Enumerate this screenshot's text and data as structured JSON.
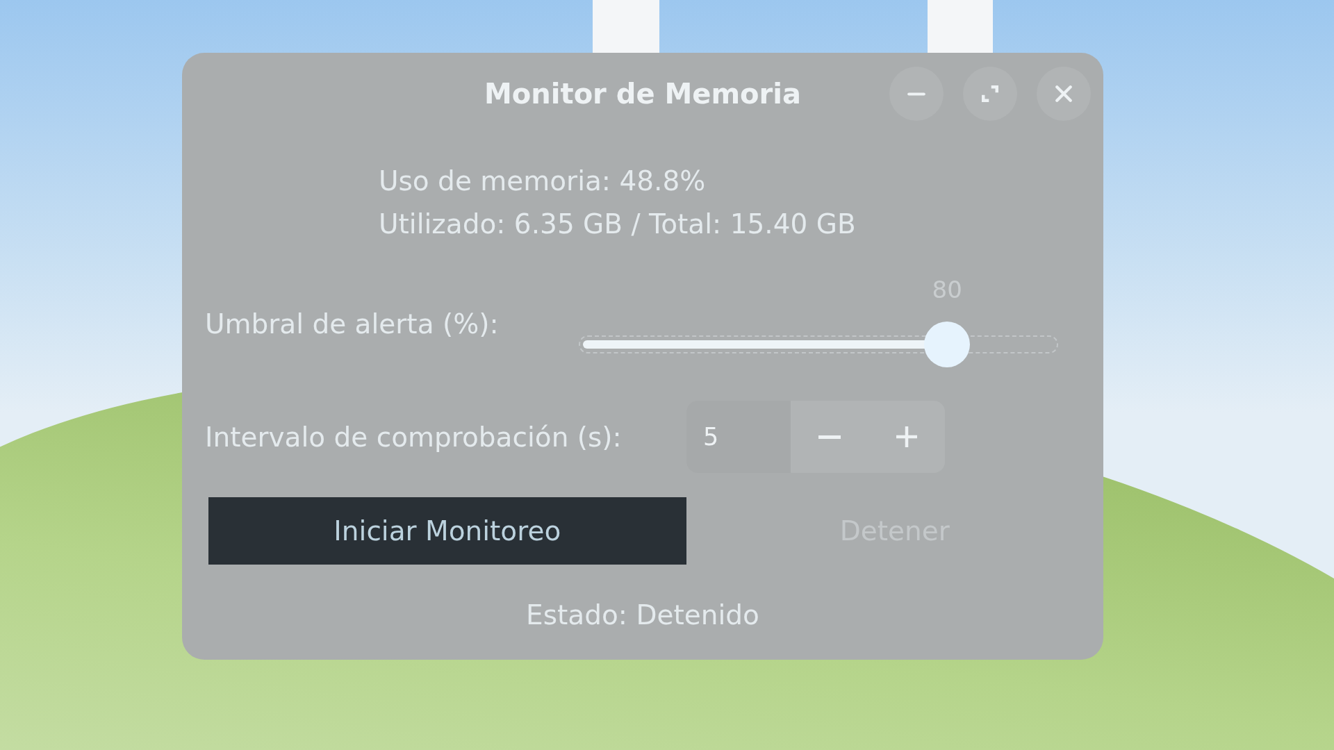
{
  "window": {
    "title": "Monitor de Memoria"
  },
  "memory": {
    "usage": "Uso de memoria: 48.8%",
    "detail": "Utilizado: 6.35 GB / Total: 15.40 GB"
  },
  "threshold": {
    "label": "Umbral de alerta (%):",
    "value": "80",
    "level": 0.77
  },
  "interval": {
    "label": "Intervalo de comprobación (s):",
    "value": "5"
  },
  "buttons": [
    {
      "label": "Iniciar Monitoreo",
      "kind": "primary",
      "disabled": false
    },
    {
      "label": "Detener",
      "kind": "flat",
      "disabled": true
    }
  ],
  "status": "Estado: Detenido"
}
